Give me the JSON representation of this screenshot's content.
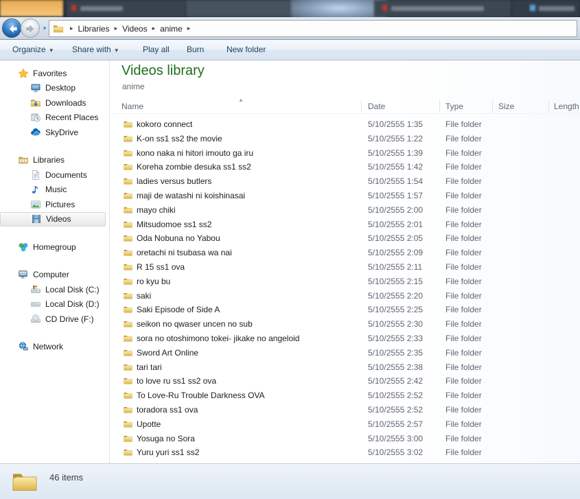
{
  "colors": {
    "title_green": "#1c701c",
    "folder_yellow": "#eed277",
    "toolbar_text": "#1d3e5e",
    "secondary_text": "#5c6573",
    "back_button_blue": "#2a6fc0"
  },
  "address_bar": {
    "back_icon": "back-icon",
    "forward_icon": "forward-icon",
    "location_icon": "folder-icon",
    "breadcrumb": [
      "Libraries",
      "Videos",
      "anime"
    ]
  },
  "toolbar": {
    "items": [
      {
        "label": "Organize",
        "dropdown": true
      },
      {
        "label": "Share with",
        "dropdown": true
      },
      {
        "label": "Play all",
        "dropdown": false
      },
      {
        "label": "Burn",
        "dropdown": false
      },
      {
        "label": "New folder",
        "dropdown": false
      }
    ]
  },
  "sidebar": {
    "sections": [
      {
        "label": "Favorites",
        "icon": "star-icon",
        "children": [
          {
            "label": "Desktop",
            "icon": "desktop-icon"
          },
          {
            "label": "Downloads",
            "icon": "downloads-icon"
          },
          {
            "label": "Recent Places",
            "icon": "recent-places-icon"
          },
          {
            "label": "SkyDrive",
            "icon": "skydrive-cloud-icon"
          }
        ]
      },
      {
        "label": "Libraries",
        "icon": "libraries-icon",
        "children": [
          {
            "label": "Documents",
            "icon": "documents-icon"
          },
          {
            "label": "Music",
            "icon": "music-note-icon"
          },
          {
            "label": "Pictures",
            "icon": "pictures-icon"
          },
          {
            "label": "Videos",
            "icon": "videos-film-icon",
            "selected": true
          }
        ]
      },
      {
        "label": "Homegroup",
        "icon": "homegroup-icon",
        "children": []
      },
      {
        "label": "Computer",
        "icon": "computer-icon",
        "children": [
          {
            "label": "Local Disk (C:)",
            "icon": "system-disk-icon"
          },
          {
            "label": "Local Disk (D:)",
            "icon": "disk-icon"
          },
          {
            "label": "CD Drive (F:)",
            "icon": "cd-drive-icon"
          }
        ]
      },
      {
        "label": "Network",
        "icon": "network-icon",
        "children": []
      }
    ]
  },
  "main": {
    "title": "Videos library",
    "subtitle": "anime",
    "columns": [
      "Name",
      "Date",
      "Type",
      "Size",
      "Length"
    ],
    "sort": {
      "column": "Name",
      "direction": "asc"
    },
    "files": [
      {
        "name": "kokoro connect",
        "date": "5/10/2555 1:35",
        "type": "File folder"
      },
      {
        "name": "K-on ss1 ss2 the movie",
        "date": "5/10/2555 1:22",
        "type": "File folder"
      },
      {
        "name": "kono naka ni hitori imouto ga iru",
        "date": "5/10/2555 1:39",
        "type": "File folder"
      },
      {
        "name": "Koreha zombie desuka ss1 ss2",
        "date": "5/10/2555 1:42",
        "type": "File folder"
      },
      {
        "name": "ladies versus butlers",
        "date": "5/10/2555 1:54",
        "type": "File folder"
      },
      {
        "name": "maji de watashi ni koishinasai",
        "date": "5/10/2555 1:57",
        "type": "File folder"
      },
      {
        "name": "mayo chiki",
        "date": "5/10/2555 2:00",
        "type": "File folder"
      },
      {
        "name": "Mitsudomoe ss1 ss2",
        "date": "5/10/2555 2:01",
        "type": "File folder"
      },
      {
        "name": "Oda Nobuna no Yabou",
        "date": "5/10/2555 2:05",
        "type": "File folder"
      },
      {
        "name": "oretachi ni tsubasa wa nai",
        "date": "5/10/2555 2:09",
        "type": "File folder"
      },
      {
        "name": "R 15 ss1 ova",
        "date": "5/10/2555 2:11",
        "type": "File folder"
      },
      {
        "name": "ro kyu bu",
        "date": "5/10/2555 2:15",
        "type": "File folder"
      },
      {
        "name": "saki",
        "date": "5/10/2555 2:20",
        "type": "File folder"
      },
      {
        "name": "Saki Episode of Side A",
        "date": "5/10/2555 2:25",
        "type": "File folder"
      },
      {
        "name": "seikon no qwaser uncen no sub",
        "date": "5/10/2555 2:30",
        "type": "File folder"
      },
      {
        "name": "sora no otoshimono tokei- jikake no angeloid",
        "date": "5/10/2555 2:33",
        "type": "File folder"
      },
      {
        "name": "Sword Art Online",
        "date": "5/10/2555 2:35",
        "type": "File folder"
      },
      {
        "name": "tari tari",
        "date": "5/10/2555 2:38",
        "type": "File folder"
      },
      {
        "name": "to love ru ss1 ss2 ova",
        "date": "5/10/2555 2:42",
        "type": "File folder"
      },
      {
        "name": "To Love-Ru Trouble Darkness OVA",
        "date": "5/10/2555 2:52",
        "type": "File folder"
      },
      {
        "name": "toradora ss1 ova",
        "date": "5/10/2555 2:52",
        "type": "File folder"
      },
      {
        "name": "Upotte",
        "date": "5/10/2555 2:57",
        "type": "File folder"
      },
      {
        "name": "Yosuga no Sora",
        "date": "5/10/2555 3:00",
        "type": "File folder"
      },
      {
        "name": "Yuru yuri ss1 ss2",
        "date": "5/10/2555 3:02",
        "type": "File folder"
      }
    ]
  },
  "status_bar": {
    "count_label": "46 items"
  }
}
